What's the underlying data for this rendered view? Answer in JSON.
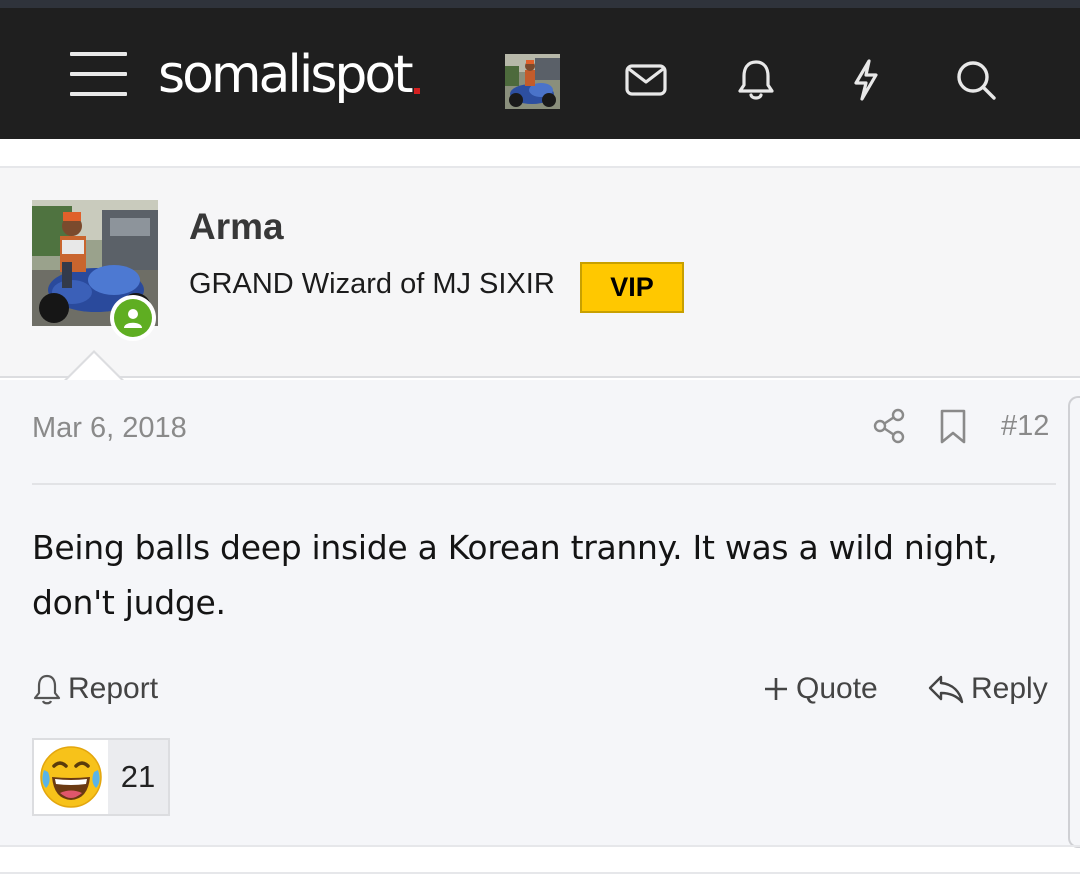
{
  "header": {
    "logo_text": "somalispot",
    "accent_color": "#d32020",
    "icons": [
      "menu-icon",
      "envelope-icon",
      "bell-icon",
      "bolt-icon",
      "search-icon"
    ]
  },
  "post": {
    "author": {
      "name": "Arma",
      "title": "GRAND Wizard of MJ SIXIR",
      "badge": "VIP",
      "online": true
    },
    "date": "Mar 6, 2018",
    "number": "#12",
    "content": "Being balls deep inside a Korean tranny. It was a wild night, don't judge.",
    "actions": {
      "report": "Report",
      "quote": "Quote",
      "reply": "Reply"
    },
    "reactions": [
      {
        "emoji": "face-with-tears-of-joy",
        "count": "21"
      }
    ]
  }
}
